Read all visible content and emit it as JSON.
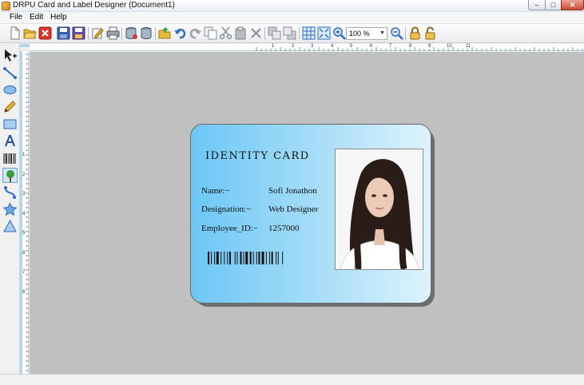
{
  "window": {
    "title": "DRPU Card and Label Designer  (Document1)",
    "minimize_glyph": "–",
    "maximize_glyph": "□",
    "close_glyph": "✕"
  },
  "menu": {
    "file": "File",
    "edit": "Edit",
    "help": "Help"
  },
  "toolbar": {
    "zoom_value": "100 %",
    "zoom_arrow": "▼"
  },
  "ruler": {
    "top_labels": [
      "1",
      "2",
      "3",
      "4",
      "5",
      "6",
      "7",
      "8",
      "9",
      "10",
      "11"
    ],
    "left_labels": [
      "1",
      "2",
      "3",
      "4",
      "5",
      "6",
      "7",
      "8"
    ]
  },
  "card": {
    "title": "IDENTITY CARD",
    "name_label": "Name:−",
    "name_value": "Sofi Jonathon",
    "designation_label": "Designation:−",
    "designation_value": "Web Designer",
    "employee_id_label": "Employee_ID:−",
    "employee_id_value": "1257000"
  },
  "colors": {
    "card_gradient_left": "#6cc7f6",
    "card_gradient_right": "#def3fd",
    "canvas_background": "#c0c0c0",
    "ruler_accent": "#b0d8ea"
  }
}
